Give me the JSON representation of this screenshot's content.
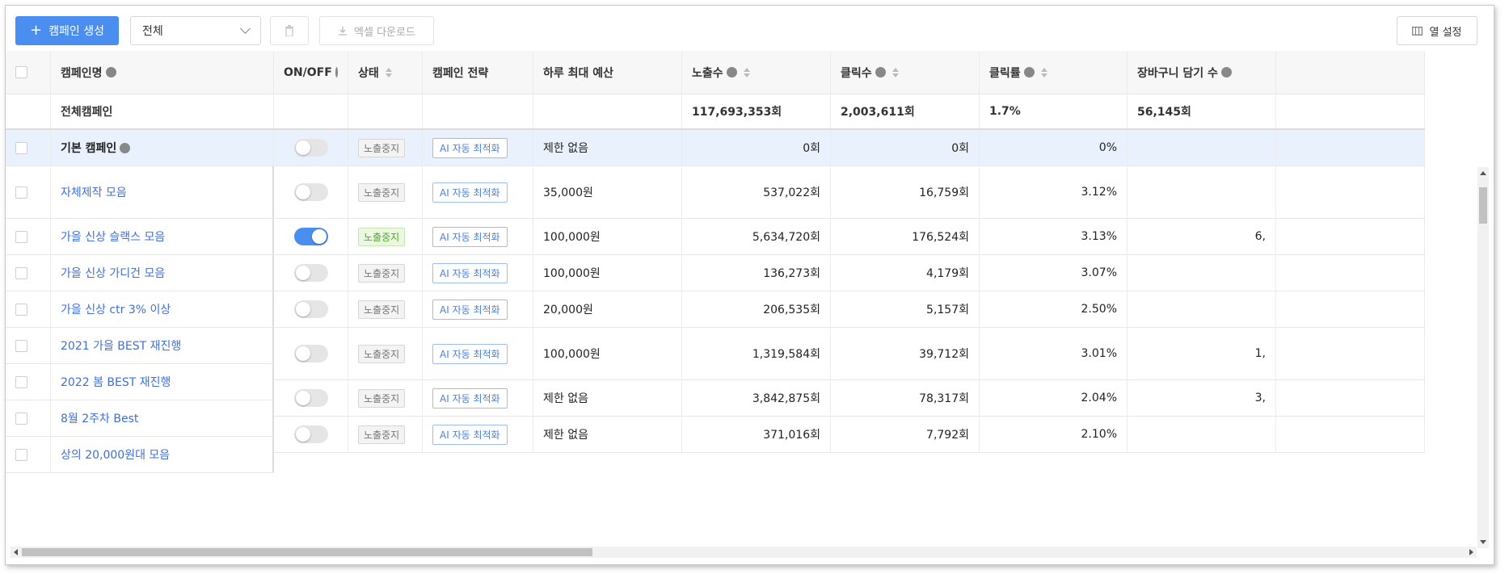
{
  "toolbar": {
    "create_label": "캠페인 생성",
    "filter_value": "전체",
    "excel_label": "엑셀 다운로드",
    "columns_label": "열 설정"
  },
  "columns": {
    "name": "캠페인명",
    "onoff": "ON/OFF",
    "status": "상태",
    "strategy": "캠페인 전략",
    "budget": "하루 최대 예산",
    "impressions": "노출수",
    "clicks": "클릭수",
    "ctr": "클릭률",
    "cart": "장바구니 담기 수"
  },
  "total": {
    "name": "전체캠페인",
    "impressions": "117,693,353회",
    "clicks": "2,003,611회",
    "ctr": "1.7%",
    "cart": "56,145회"
  },
  "default_campaign": {
    "name": "기본 캠페인",
    "status": "노출중지",
    "strategy": "AI 자동 최적화",
    "budget": "제한 없음",
    "impressions": "0회",
    "clicks": "0회",
    "ctr": "0%"
  },
  "names": [
    "자체제작 모음",
    "가을 신상 슬랙스 모음",
    "가을 신상 가디건 모음",
    "가을 신상 ctr 3% 이상",
    "2021 가을 BEST 재진행",
    "2022 봄 BEST 재진행",
    "8월 2주차 Best",
    "상의 20,000원대 모음"
  ],
  "rows": [
    {
      "status": "노출중지",
      "strategy": "AI 자동 최적화",
      "budget": "35,000원",
      "impressions": "537,022회",
      "clicks": "16,759회",
      "ctr": "3.12%",
      "cart": ""
    },
    {
      "status": "노출중지",
      "strategy": "AI 자동 최적화",
      "budget": "100,000원",
      "impressions": "5,634,720회",
      "clicks": "176,524회",
      "ctr": "3.13%",
      "cart": "6,"
    },
    {
      "status": "노출중지",
      "strategy": "AI 자동 최적화",
      "budget": "100,000원",
      "impressions": "136,273회",
      "clicks": "4,179회",
      "ctr": "3.07%",
      "cart": ""
    },
    {
      "status": "노출중지",
      "strategy": "AI 자동 최적화",
      "budget": "20,000원",
      "impressions": "206,535회",
      "clicks": "5,157회",
      "ctr": "2.50%",
      "cart": ""
    },
    {
      "status": "노출중지",
      "strategy": "AI 자동 최적화",
      "budget": "100,000원",
      "impressions": "1,319,584회",
      "clicks": "39,712회",
      "ctr": "3.01%",
      "cart": "1,"
    },
    {
      "status": "노출중지",
      "strategy": "AI 자동 최적화",
      "budget": "제한 없음",
      "impressions": "3,842,875회",
      "clicks": "78,317회",
      "ctr": "2.04%",
      "cart": "3,"
    },
    {
      "status": "노출중지",
      "strategy": "AI 자동 최적화",
      "budget": "제한 없음",
      "impressions": "371,016회",
      "clicks": "7,792회",
      "ctr": "2.10%",
      "cart": ""
    }
  ],
  "colors": {
    "accent": "#4a8ef0",
    "link": "#3f6fd6",
    "selected_row": "#e8f1fc"
  }
}
